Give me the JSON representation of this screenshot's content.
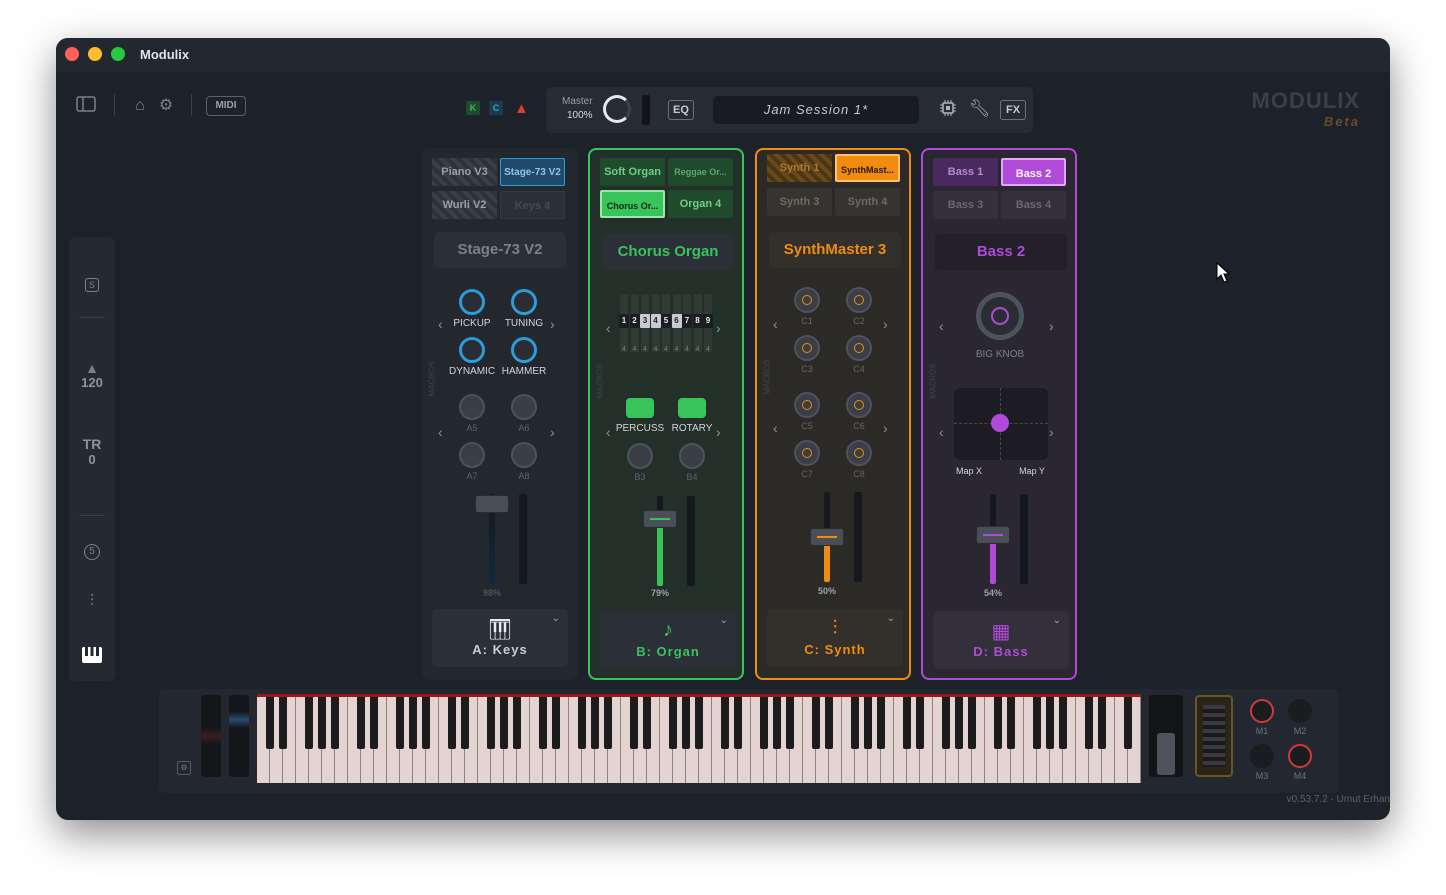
{
  "window": {
    "title": "Modulix"
  },
  "toolbar": {
    "midi_label": "MIDI",
    "k_badge": "K",
    "c_badge": "C"
  },
  "topbar": {
    "master_label": "Master",
    "master_value": "100%",
    "eq_label": "EQ",
    "session_name": "Jam Session 1*",
    "fx_label": "FX"
  },
  "brand": {
    "name": "MODULIX",
    "tag": "Beta"
  },
  "sidebar": {
    "s_label": "S",
    "tempo_value": "120",
    "tr_label": "TR",
    "tr_value": "0",
    "five_label": "5"
  },
  "strips": [
    {
      "id": "A",
      "tiles": [
        "Piano V3",
        "Stage-73 V2",
        "Wurli V2",
        "Keys 4"
      ],
      "name": "Stage-73 V2",
      "perf_knobs": [
        "PICKUP",
        "TUNING",
        "DYNAMIC",
        "HAMMER"
      ],
      "slots": [
        "A5",
        "A6",
        "A7",
        "A8"
      ],
      "level": "98%",
      "footer": "A: Keys",
      "accent": "#2e9cdb"
    },
    {
      "id": "B",
      "tiles": [
        "Soft Organ",
        "Reggae Or...",
        "Chorus Or...",
        "Organ 4"
      ],
      "name": "Chorus Organ",
      "drawbars": [
        "1",
        "2",
        "3",
        "4",
        "5",
        "6",
        "7",
        "8",
        "9"
      ],
      "drawbar_values": [
        "4",
        "4",
        "4",
        "4",
        "4",
        "4",
        "4",
        "4",
        "4"
      ],
      "toggles": [
        "PERCUSS",
        "ROTARY"
      ],
      "slots": [
        "B3",
        "B4"
      ],
      "level": "79%",
      "footer": "B: Organ",
      "accent": "#38c45a"
    },
    {
      "id": "C",
      "tiles": [
        "Synth 1",
        "SynthMast...",
        "Synth 3",
        "Synth 4"
      ],
      "name": "SynthMaster 3",
      "slots": [
        "C1",
        "C2",
        "C3",
        "C4",
        "C5",
        "C6",
        "C7",
        "C8"
      ],
      "level": "50%",
      "footer": "C: Synth",
      "accent": "#f08c10"
    },
    {
      "id": "D",
      "tiles": [
        "Bass 1",
        "Bass 2",
        "Bass 3",
        "Bass 4"
      ],
      "name": "Bass 2",
      "big_knob": "BIG KNOB",
      "map_x": "Map X",
      "map_y": "Map Y",
      "level": "54%",
      "footer": "D: Bass",
      "accent": "#b04ad8"
    }
  ],
  "keyboard": {
    "macros": [
      "M1",
      "M2",
      "M3",
      "M4"
    ]
  },
  "version": "v0.53.7.2 - Umut Erhan"
}
